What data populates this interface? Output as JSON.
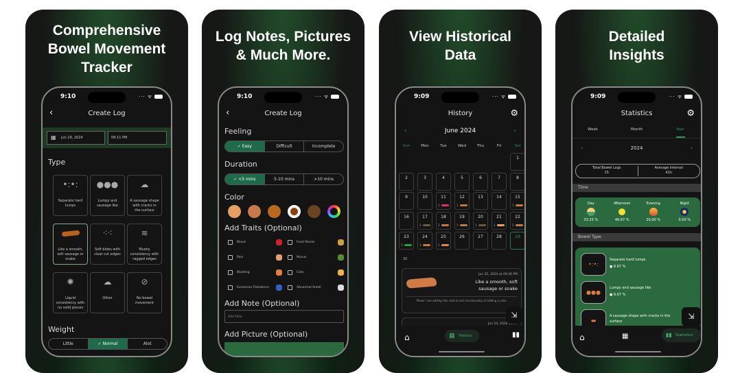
{
  "panels": [
    {
      "headline": [
        "Comprehensive",
        "Bowel Movement",
        "Tracker"
      ]
    },
    {
      "headline": [
        "Log Notes, Pictures",
        "& Much More."
      ]
    },
    {
      "headline": [
        "View Historical",
        "Data"
      ]
    },
    {
      "headline": [
        "Detailed",
        "Insights"
      ]
    }
  ],
  "status": {
    "time_a": "9:10",
    "time_b": "9:09"
  },
  "create_log": {
    "title": "Create Log",
    "date": "Jun 29, 2024",
    "time": "09:11 PM",
    "type_label": "Type",
    "types": [
      {
        "label": "Separate hard lumps",
        "icon": "lumps-icon",
        "selected": false
      },
      {
        "label": "Lumpy and sausage like",
        "icon": "lumpy-icon",
        "selected": false
      },
      {
        "label": "A sausage shape with cracks in the surface",
        "icon": "cracked-sausage-icon",
        "selected": false
      },
      {
        "label": "Like a smooth, soft sausage or snake",
        "icon": "smooth-sausage-icon",
        "selected": true
      },
      {
        "label": "Soft blobs with clear cut edges",
        "icon": "soft-blobs-icon",
        "selected": false
      },
      {
        "label": "Mushy consistency with ragged edges",
        "icon": "mushy-icon",
        "selected": false
      },
      {
        "label": "Liquid consistency with no solid pieces",
        "icon": "liquid-icon",
        "selected": false
      },
      {
        "label": "Other",
        "icon": "cloud-icon",
        "selected": false
      },
      {
        "label": "No bowel movement",
        "icon": "no-entry-icon",
        "selected": false
      }
    ],
    "weight_label": "Weight",
    "weight_options": [
      "Little",
      "Normal",
      "Alot"
    ],
    "weight_selected": "Normal",
    "feeling_label": "Feeling",
    "feeling_options": [
      "Easy",
      "Difficult",
      "Incomplete"
    ],
    "feeling_selected": "Easy",
    "duration_label": "Duration",
    "duration_options": [
      "<5 mins",
      "5-10 mins",
      ">10 mins"
    ],
    "duration_selected": "<5 mins",
    "color_label": "Color",
    "colors": [
      "#e8a060",
      "#c8784a",
      "#b8691e",
      "#8a3f0e",
      "#6a4420",
      "rainbow"
    ],
    "color_selected_index": 3,
    "traits_label": "Add Traits (Optional)",
    "traits": [
      {
        "label": "Blood",
        "icon": "blood-drops-icon",
        "color": "#d02030"
      },
      {
        "label": "Food Pieces",
        "icon": "food-icon",
        "color": "#c8a040"
      },
      {
        "label": "Pain",
        "icon": "pain-face-icon",
        "color": "#e0a070"
      },
      {
        "label": "Mucus",
        "icon": "mucus-icon",
        "color": "#5a8a30"
      },
      {
        "label": "Bloating",
        "icon": "bloating-icon",
        "color": "#e08040"
      },
      {
        "label": "Colic",
        "icon": "colic-icon",
        "color": "#f0b050"
      },
      {
        "label": "Excessive Flatulence",
        "icon": "flatulence-icon",
        "color": "#3060c0"
      },
      {
        "label": "Abnormal Smell",
        "icon": "smell-icon",
        "color": "#dddddd"
      }
    ],
    "note_label": "Add Note (Optional)",
    "note_placeholder": "Add Note",
    "picture_label": "Add Picture (Optional)"
  },
  "history": {
    "title": "History",
    "month": "June 2024",
    "weekdays": [
      "Sun",
      "Mon",
      "Tue",
      "Wed",
      "Thu",
      "Fri",
      "Sat"
    ],
    "days": [
      {
        "d": "1"
      },
      {
        "d": "2"
      },
      {
        "d": "3"
      },
      {
        "d": "4"
      },
      {
        "d": "5"
      },
      {
        "d": "6"
      },
      {
        "d": "7"
      },
      {
        "d": "8"
      },
      {
        "d": "9"
      },
      {
        "d": "10"
      },
      {
        "d": "11",
        "count": "1",
        "color": "#e0306a"
      },
      {
        "d": "12",
        "count": "1",
        "color": "#c8782a"
      },
      {
        "d": "13"
      },
      {
        "d": "14"
      },
      {
        "d": "15",
        "count": "1",
        "color": "#c8783a"
      },
      {
        "d": "16"
      },
      {
        "d": "17",
        "count": "1",
        "color": "#6a5a40"
      },
      {
        "d": "18",
        "count": "2",
        "color": "#c8783a"
      },
      {
        "d": "19",
        "count": "1",
        "color": "#c8783a"
      },
      {
        "d": "20",
        "count": "1",
        "color": "#6a5a40"
      },
      {
        "d": "21",
        "count": "1",
        "color": "#f0a060"
      },
      {
        "d": "22",
        "count": "2",
        "color": "#c8783a"
      },
      {
        "d": "23",
        "count": "1",
        "color": "#2a9a3a"
      },
      {
        "d": "24",
        "count": "1",
        "color": "#c8783a"
      },
      {
        "d": "25",
        "count": "1",
        "color": "#e0884a"
      },
      {
        "d": "26"
      },
      {
        "d": "27"
      },
      {
        "d": "28"
      },
      {
        "d": "29",
        "today": true
      }
    ],
    "extra_day": "30",
    "entries": [
      {
        "timestamp": "Jun 25, 2024 at 09:36 PM",
        "type": "Like a smooth, soft sausage or snake",
        "note": "Phew! I am adding this note to test functionality of adding a note."
      },
      {
        "timestamp": "Jun 24, 2024 at 0...",
        "type": "",
        "note": ""
      }
    ],
    "nav_active": "History"
  },
  "statistics": {
    "title": "Statistics",
    "tabs": [
      "Week",
      "Month",
      "Year"
    ],
    "active_tab": "Year",
    "period": "2024",
    "total_label": "Total Bowel Logs",
    "total_value": "15",
    "interval_label": "Average Interval",
    "interval_value": "41h",
    "time_section": "Time",
    "times": [
      {
        "label": "Day",
        "value": "33.33 %",
        "icon": "sunrise-icon"
      },
      {
        "label": "Afternoon",
        "value": "46.67 %",
        "icon": "sun-icon"
      },
      {
        "label": "Evening",
        "value": "20.00 %",
        "icon": "sunset-icon"
      },
      {
        "label": "Night",
        "value": "0.00 %",
        "icon": "moon-icon"
      }
    ],
    "type_section": "Bowel Type",
    "types": [
      {
        "label": "Separate hard lumps",
        "value": "6.67 %"
      },
      {
        "label": "Lumpy and sausage like",
        "value": "6.67 %"
      },
      {
        "label": "A sausage shape with cracks in the surface",
        "value": "6.67 %"
      }
    ],
    "nav_active": "Statistics"
  },
  "colors": {
    "accent": "#1d6b4a",
    "card_green": "#2a6a3e",
    "background": "#141414"
  }
}
